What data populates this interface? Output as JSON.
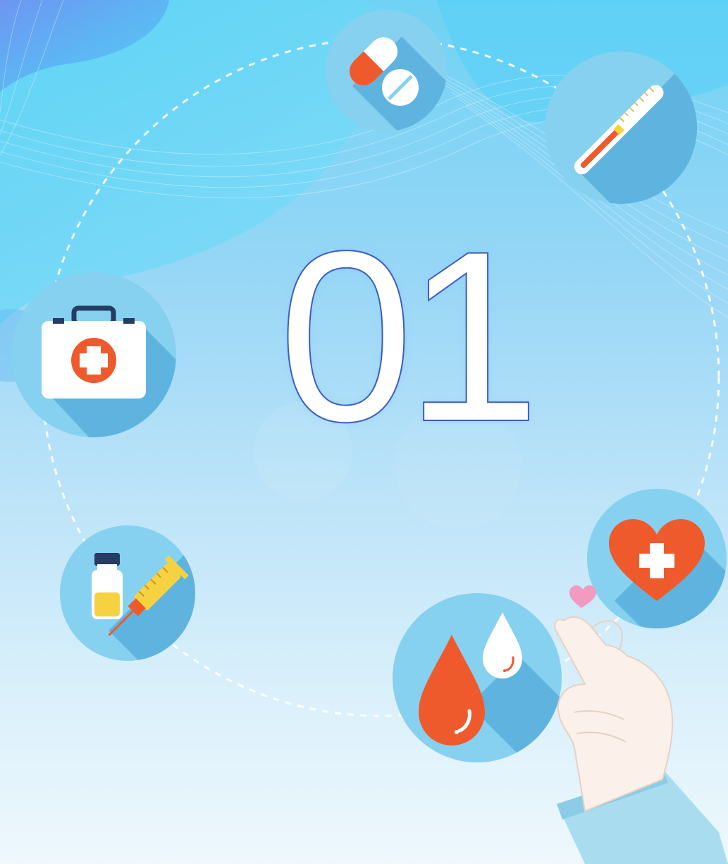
{
  "section": {
    "number": "01"
  },
  "icons": [
    "pills-icon",
    "thermometer-icon",
    "first-aid-kit-icon",
    "vaccine-syringe-icon",
    "blood-drops-icon",
    "heart-plus-icon",
    "finger-heart-hand-icon"
  ],
  "colors": {
    "background_top": "#6fd2f4",
    "background_bottom": "#eef8fd",
    "badge_fill": "#86d0f0",
    "badge_shadow": "#5fb4df",
    "accent_red": "#ef5a2c",
    "accent_yellow": "#f7d240",
    "number_outline": "#3a5ec4",
    "dashed_ring": "#ffffff"
  }
}
